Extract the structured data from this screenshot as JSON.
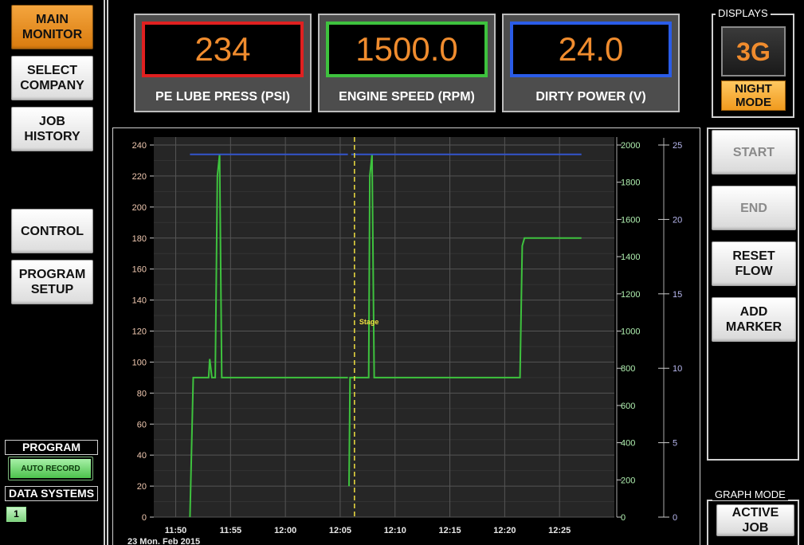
{
  "nav": {
    "main_monitor": "MAIN MONITOR",
    "select_company": "SELECT COMPANY",
    "job_history": "JOB HISTORY",
    "control": "CONTROL",
    "program_setup": "PROGRAM SETUP"
  },
  "program": {
    "label": "PROGRAM",
    "auto_record": "AUTO RECORD",
    "data_systems_label": "DATA SYSTEMS",
    "data_system_id": "1"
  },
  "gauges": [
    {
      "value": "234",
      "label": "PE LUBE PRESS (PSI)",
      "color": "#e02020"
    },
    {
      "value": "1500.0",
      "label": "ENGINE SPEED (RPM)",
      "color": "#3ec23e"
    },
    {
      "value": "24.0",
      "label": "DIRTY POWER (V)",
      "color": "#2a5ce8"
    }
  ],
  "displays": {
    "title": "DISPLAYS",
    "mode": "3G",
    "night_mode": "NIGHT MODE"
  },
  "actions": {
    "start": "START",
    "end": "END",
    "reset_flow": "RESET FLOW",
    "add_marker": "ADD MARKER"
  },
  "graph_mode": {
    "title": "GRAPH MODE",
    "active_job": "ACTIVE JOB"
  },
  "colors": {
    "accent_orange": "#f08c2e",
    "green_series": "#3ec23e",
    "blue_series": "#3355cc",
    "marker_yellow": "#f0e040"
  },
  "chart_data": {
    "type": "line",
    "x_ticks": [
      "11:50",
      "11:55",
      "12:00",
      "12:05",
      "12:10",
      "12:15",
      "12:20",
      "12:25"
    ],
    "date_label": "23 Mon. Feb 2015",
    "x_range": [
      "11:48",
      "12:30"
    ],
    "y_left": {
      "min": 0,
      "max": 240,
      "ticks": [
        0,
        20,
        40,
        60,
        80,
        100,
        120,
        140,
        160,
        180,
        200,
        220,
        240
      ],
      "color": "#f0c8b0"
    },
    "y_right_1": {
      "min": 0,
      "max": 2000,
      "ticks": [
        0,
        200,
        400,
        600,
        800,
        1000,
        1200,
        1400,
        1600,
        1800,
        2000
      ],
      "color": "#b0f0b0"
    },
    "y_right_2": {
      "min": 0,
      "max": 25,
      "ticks": [
        0,
        5,
        10,
        15,
        20,
        25
      ],
      "color": "#b8b8f0"
    },
    "grid": true,
    "marker": {
      "time": "12:06.3",
      "label": "Stage"
    },
    "series": [
      {
        "axis": "left",
        "color": "#3ec23e",
        "segments": [
          [
            [
              "11:51.3",
              0
            ],
            [
              "11:51.6",
              90
            ],
            [
              "11:53.0",
              90
            ],
            [
              "11:53.1",
              102
            ],
            [
              "11:53.3",
              90
            ],
            [
              "11:53.6",
              90
            ],
            [
              "11:53.8",
              220
            ],
            [
              "11:54.0",
              234
            ],
            [
              "11:54.2",
              90
            ],
            [
              "12:05.7",
              90
            ]
          ],
          [
            [
              "12:05.8",
              20
            ],
            [
              "12:05.9",
              90
            ],
            [
              "12:07.6",
              90
            ],
            [
              "12:07.7",
              220
            ],
            [
              "12:07.9",
              234
            ],
            [
              "12:08.1",
              90
            ],
            [
              "12:21.4",
              90
            ],
            [
              "12:21.6",
              175
            ],
            [
              "12:21.8",
              180
            ],
            [
              "12:27.0",
              180
            ]
          ]
        ]
      },
      {
        "axis": "left",
        "color": "#3355cc",
        "segments": [
          [
            [
              "11:51.3",
              234
            ],
            [
              "12:05.7",
              234
            ]
          ],
          [
            [
              "12:06.0",
              234
            ],
            [
              "12:27.0",
              234
            ]
          ]
        ]
      }
    ]
  }
}
